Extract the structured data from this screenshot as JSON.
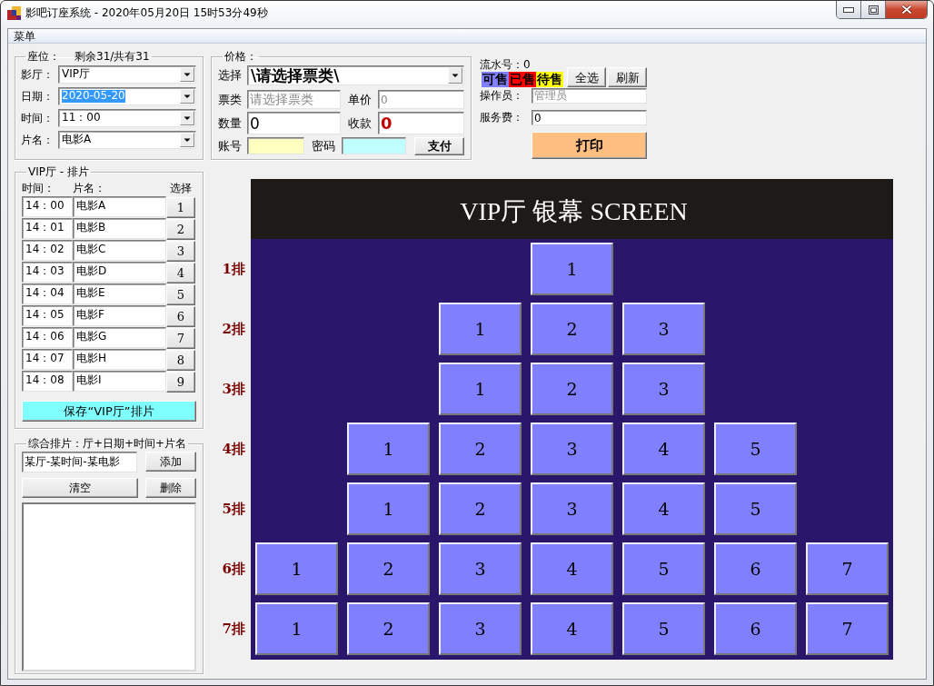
{
  "window": {
    "title": "影吧订座系统 - 2020年05月20日 15时53分49秒"
  },
  "menu": [
    "菜单"
  ],
  "seat_group": {
    "legend": "座位：",
    "summary": "剩余31/共有31",
    "fields": [
      {
        "label": "影厅：",
        "value": "VIP厅",
        "highlighted": false
      },
      {
        "label": "日期：",
        "value": "2020-05-20",
        "highlighted": true
      },
      {
        "label": "时间：",
        "value": "11：00",
        "highlighted": false
      },
      {
        "label": "片名：",
        "value": "电影A",
        "highlighted": false
      }
    ]
  },
  "price_group": {
    "legend": "价格：",
    "select": {
      "label": "选择",
      "value": "\\请选择票类\\"
    },
    "ticket_type": {
      "label": "票类",
      "value": "请选择票类",
      "disabled": true
    },
    "unit_price": {
      "label": "单价",
      "value": "0",
      "disabled": true
    },
    "quantity": {
      "label": "数量",
      "value": "0"
    },
    "received": {
      "label": "收款",
      "value": "0"
    },
    "account": {
      "label": "账号"
    },
    "password": {
      "label": "密码"
    },
    "pay_button": "支付"
  },
  "status_panel": {
    "serial": "流水号：0",
    "legend": [
      {
        "label": "可售",
        "color": "#8080ff"
      },
      {
        "label": "已售",
        "color": "#ff0000"
      },
      {
        "label": "待售",
        "color": "#ffff00"
      }
    ],
    "select_all_button": "全选",
    "refresh_button": "刷新",
    "operator": {
      "label": "操作员：",
      "value": "管理员",
      "disabled": true
    },
    "service_fee": {
      "label": "服务费：",
      "value": "0"
    },
    "print_button": "打印"
  },
  "schedule_group": {
    "legend": "VIP厅 - 排片",
    "headers": [
      "时间：",
      "片名：",
      "选择"
    ],
    "rows": [
      {
        "time": "14：00",
        "movie": "电影A",
        "button": "1"
      },
      {
        "time": "14：01",
        "movie": "电影B",
        "button": "2"
      },
      {
        "time": "14：02",
        "movie": "电影C",
        "button": "3"
      },
      {
        "time": "14：03",
        "movie": "电影D",
        "button": "4"
      },
      {
        "time": "14：04",
        "movie": "电影E",
        "button": "5"
      },
      {
        "time": "14：05",
        "movie": "电影F",
        "button": "6"
      },
      {
        "time": "14：06",
        "movie": "电影G",
        "button": "7"
      },
      {
        "time": "14：07",
        "movie": "电影H",
        "button": "8"
      },
      {
        "time": "14：08",
        "movie": "电影I",
        "button": "9"
      }
    ],
    "save_button": "保存“VIP厅”排片"
  },
  "combined_group": {
    "legend": "综合排片：厅+日期+时间+片名",
    "entry": {
      "value": "某厅-某时间-某电影"
    },
    "add_button": "添加",
    "clear_button": "清空",
    "delete_button": "删除"
  },
  "seat_map": {
    "screen_title": "VIP厅 银幕 SCREEN",
    "rows": [
      {
        "label": "1排",
        "seats": [
          {
            "number": "1",
            "sold": false
          }
        ]
      },
      {
        "label": "2排",
        "seats": [
          {
            "number": "1",
            "sold": false
          },
          {
            "number": "2",
            "sold": false
          },
          {
            "number": "3",
            "sold": false
          }
        ]
      },
      {
        "label": "3排",
        "seats": [
          {
            "number": "1",
            "sold": false
          },
          {
            "number": "2",
            "sold": false
          },
          {
            "number": "3",
            "sold": false
          }
        ]
      },
      {
        "label": "4排",
        "seats": [
          {
            "number": "1",
            "sold": false
          },
          {
            "number": "2",
            "sold": false
          },
          {
            "number": "3",
            "sold": false
          },
          {
            "number": "4",
            "sold": false
          },
          {
            "number": "5",
            "sold": false
          }
        ]
      },
      {
        "label": "5排",
        "seats": [
          {
            "number": "1",
            "sold": false
          },
          {
            "number": "2",
            "sold": false
          },
          {
            "number": "3",
            "sold": false
          },
          {
            "number": "4",
            "sold": false
          },
          {
            "number": "5",
            "sold": false
          }
        ]
      },
      {
        "label": "6排",
        "seats": [
          {
            "number": "1",
            "sold": false
          },
          {
            "number": "2",
            "sold": false
          },
          {
            "number": "3",
            "sold": false
          },
          {
            "number": "4",
            "sold": false
          },
          {
            "number": "5",
            "sold": false
          },
          {
            "number": "6",
            "sold": false
          },
          {
            "number": "7",
            "sold": false
          }
        ]
      },
      {
        "label": "7排",
        "seats": [
          {
            "number": "1",
            "sold": false
          },
          {
            "number": "2",
            "sold": false
          },
          {
            "number": "3",
            "sold": false
          },
          {
            "number": "4",
            "sold": false
          },
          {
            "number": "5",
            "sold": false
          },
          {
            "number": "6",
            "sold": false
          },
          {
            "number": "7",
            "sold": false
          }
        ]
      }
    ]
  }
}
